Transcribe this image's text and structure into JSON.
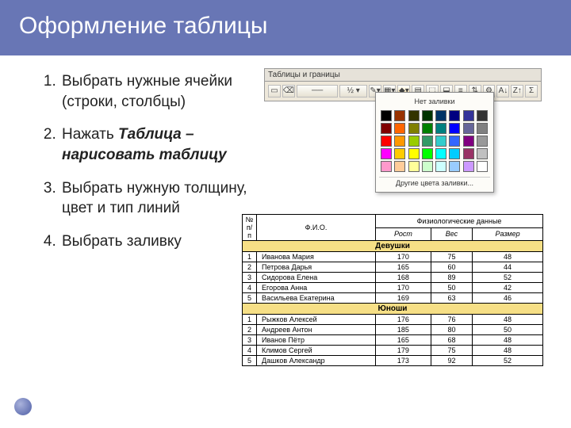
{
  "title": "Оформление таблицы",
  "steps": [
    {
      "text_a": "Выбрать нужные ячейки (строки, столбцы)"
    },
    {
      "text_a": "Нажать ",
      "em": "Таблица – нарисовать таблицу"
    },
    {
      "text_a": "Выбрать нужную толщину, цвет и тип линий"
    },
    {
      "text_a": "Выбрать заливку"
    }
  ],
  "palette": {
    "toolbar_title": "Таблицы и границы",
    "no_fill": "Нет заливки",
    "more_colors": "Другие цвета заливки...",
    "colors": [
      "#000000",
      "#993300",
      "#333300",
      "#003300",
      "#003366",
      "#000080",
      "#333399",
      "#333333",
      "#800000",
      "#ff6600",
      "#808000",
      "#008000",
      "#008080",
      "#0000ff",
      "#666699",
      "#808080",
      "#ff0000",
      "#ff9900",
      "#99cc00",
      "#339966",
      "#33cccc",
      "#3366ff",
      "#800080",
      "#999999",
      "#ff00ff",
      "#ffcc00",
      "#ffff00",
      "#00ff00",
      "#00ffff",
      "#00ccff",
      "#993366",
      "#c0c0c0",
      "#ff99cc",
      "#ffcc99",
      "#ffff99",
      "#ccffcc",
      "#ccffff",
      "#99ccff",
      "#cc99ff",
      "#ffffff"
    ]
  },
  "chart_data": {
    "type": "table",
    "headers": {
      "num": "№ п/п",
      "fio": "Ф.И.О.",
      "phys_group": "Физиологические данные",
      "height": "Рост",
      "weight": "Вес",
      "size": "Размер"
    },
    "groups": [
      {
        "label": "Девушки",
        "class": "girls",
        "rows": [
          {
            "n": 1,
            "fio": "Иванова Мария",
            "h": 170,
            "w": 75,
            "s": 48
          },
          {
            "n": 2,
            "fio": "Петрова Дарья",
            "h": 165,
            "w": 60,
            "s": 44
          },
          {
            "n": 3,
            "fio": "Сидорова Елена",
            "h": 168,
            "w": 89,
            "s": 52
          },
          {
            "n": 4,
            "fio": "Егорова Анна",
            "h": 170,
            "w": 50,
            "s": 42
          },
          {
            "n": 5,
            "fio": "Васильева Екатерина",
            "h": 169,
            "w": 63,
            "s": 46
          }
        ]
      },
      {
        "label": "Юноши",
        "class": "boys",
        "rows": [
          {
            "n": 1,
            "fio": "Рыжков Алексей",
            "h": 176,
            "w": 76,
            "s": 48
          },
          {
            "n": 2,
            "fio": "Андреев Антон",
            "h": 185,
            "w": 80,
            "s": 50
          },
          {
            "n": 3,
            "fio": "Иванов Пётр",
            "h": 165,
            "w": 68,
            "s": 48
          },
          {
            "n": 4,
            "fio": "Климов Сергей",
            "h": 179,
            "w": 75,
            "s": 48
          },
          {
            "n": 5,
            "fio": "Дашков Александр",
            "h": 173,
            "w": 92,
            "s": 52
          }
        ]
      }
    ]
  }
}
